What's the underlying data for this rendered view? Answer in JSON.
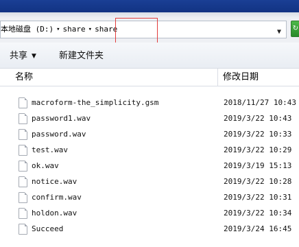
{
  "address": {
    "drive": "本地磁盘 (D:)",
    "folder": "share",
    "current": "share",
    "dropdown_icon": "chevron-down-icon",
    "refresh_icon": "refresh-icon"
  },
  "toolbar": {
    "share_label": "共享",
    "new_folder_label": "新建文件夹"
  },
  "columns": {
    "name": "名称",
    "date_modified": "修改日期"
  },
  "files": [
    {
      "name": "macroform-the_simplicity.gsm",
      "date": "2018/11/27 10:43"
    },
    {
      "name": "password1.wav",
      "date": "2019/3/22 10:43"
    },
    {
      "name": "password.wav",
      "date": "2019/3/22 10:33"
    },
    {
      "name": "test.wav",
      "date": "2019/3/22 10:29"
    },
    {
      "name": "ok.wav",
      "date": "2019/3/19 15:13"
    },
    {
      "name": "notice.wav",
      "date": "2019/3/22 10:28"
    },
    {
      "name": "confirm.wav",
      "date": "2019/3/22 10:31"
    },
    {
      "name": "holdon.wav",
      "date": "2019/3/22 10:34"
    },
    {
      "name": "Succeed",
      "date": "2019/3/24 16:45"
    }
  ]
}
